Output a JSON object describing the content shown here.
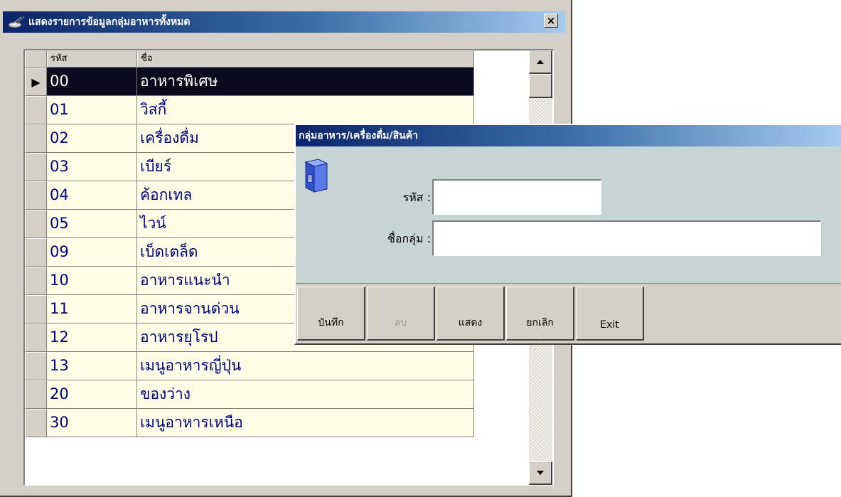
{
  "back_window": {
    "title": "แสดงรายการข้อมูลกลุ่มอาหารทั้งหมด",
    "close_label": "×",
    "columns": {
      "code": "รหัส",
      "name": "ชื่อ"
    },
    "rows": [
      {
        "code": "00",
        "name": "อาหารพิเศษ",
        "selected": true,
        "indicator": "▶"
      },
      {
        "code": "01",
        "name": "วิสกี้"
      },
      {
        "code": "02",
        "name": "เครื่องดื่ม"
      },
      {
        "code": "03",
        "name": "เบียร์"
      },
      {
        "code": "04",
        "name": "ค้อกเทล"
      },
      {
        "code": "05",
        "name": "ไวน์"
      },
      {
        "code": "09",
        "name": "เบ็ดเตล็ด"
      },
      {
        "code": "10",
        "name": "อาหารแนะนำ"
      },
      {
        "code": "11",
        "name": "อาหารจานด่วน"
      },
      {
        "code": "12",
        "name": "อาหารยุโรป"
      },
      {
        "code": "13",
        "name": "เมนูอาหารญี่ปุ่น"
      },
      {
        "code": "20",
        "name": "ของว่าง"
      },
      {
        "code": "30",
        "name": "เมนูอาหารเหนือ"
      }
    ]
  },
  "dialog": {
    "title": "กลุ่มอาหาร/เครื่องดื่ม/สินค้า",
    "code_label": "รหัส :",
    "code_value": "",
    "name_label": "ชื่อกลุ่ม :",
    "name_value": "",
    "buttons": {
      "save": "บันทึก",
      "delete": "ลบ",
      "show": "แสดง",
      "cancel": "ยกเลิก",
      "exit": "Exit"
    }
  },
  "colors": {
    "selected_row_bg": "#0a0a1e",
    "cell_bg": "#ffffe8",
    "cell_text": "#000080",
    "dialog_bg": "#c5d5d2",
    "titlebar_start": "#0a246a"
  }
}
